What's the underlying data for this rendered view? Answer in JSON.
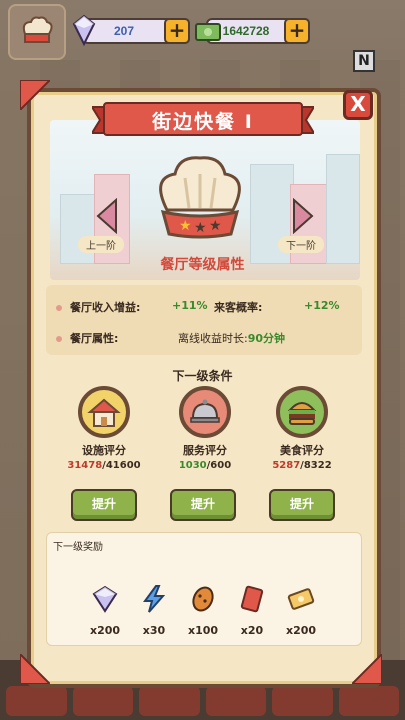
{
  "top_bar": {
    "gems": "207",
    "cash": "1642728",
    "plus_label": "+",
    "badge_letter": "N"
  },
  "panel": {
    "title": "街边快餐 Ⅰ",
    "close_label": "X",
    "prev_label": "上一阶",
    "next_label": "下一阶",
    "scene_title": "餐厅等级属性"
  },
  "attributes": {
    "income_label": "餐厅收入增益:",
    "income_value": "+11%",
    "visitor_label": "来客概率:",
    "visitor_value": "+12%",
    "prop_label": "餐厅属性:",
    "offline_label": "离线收益时长:",
    "offline_value": "90分钟"
  },
  "conditions": {
    "title": "下一级条件",
    "items": [
      {
        "name": "设施评分",
        "current": "31478",
        "total": "/41600",
        "icon": "house-icon"
      },
      {
        "name": "服务评分",
        "current": "1030",
        "total": "/600",
        "icon": "cloche-icon"
      },
      {
        "name": "美食评分",
        "current": "5287",
        "total": "/8322",
        "icon": "burger-icon"
      }
    ],
    "upgrade_label": "提升"
  },
  "rewards": {
    "title": "下一级奖励",
    "items": [
      {
        "icon": "gem-icon",
        "qty": "x200"
      },
      {
        "icon": "lightning-icon",
        "qty": "x30"
      },
      {
        "icon": "cookie-icon",
        "qty": "x100"
      },
      {
        "icon": "red-ticket-icon",
        "qty": "x20"
      },
      {
        "icon": "gold-ticket-icon",
        "qty": "x200"
      }
    ]
  },
  "colors": {
    "accent_red": "#d94a3c",
    "progress_red": "#c03a2c",
    "progress_green": "#3a8a2c",
    "button_green": "#8fb34a"
  }
}
